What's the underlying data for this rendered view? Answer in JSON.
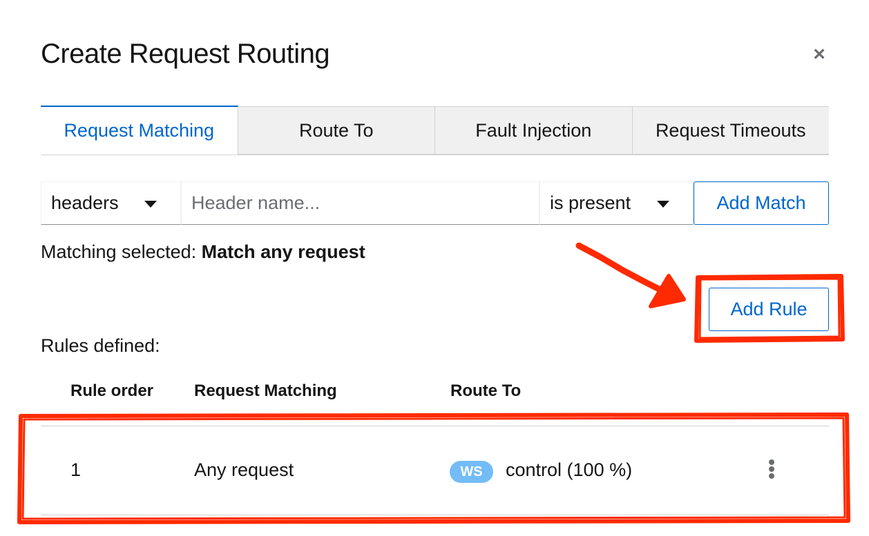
{
  "modal": {
    "title": "Create Request Routing",
    "close_glyph": "×"
  },
  "tabs": [
    {
      "label": "Request Matching",
      "active": true
    },
    {
      "label": "Route To",
      "active": false
    },
    {
      "label": "Fault Injection",
      "active": false
    },
    {
      "label": "Request Timeouts",
      "active": false
    }
  ],
  "match_form": {
    "kind_select": "headers",
    "header_placeholder": "Header name...",
    "operator_select": "is present",
    "add_match_label": "Add Match"
  },
  "matching_selected": {
    "prefix": "Matching selected: ",
    "value": "Match any request"
  },
  "add_rule_label": "Add Rule",
  "rules_defined_label": "Rules defined:",
  "rules_table": {
    "headers": [
      "Rule order",
      "Request Matching",
      "Route To"
    ],
    "rows": [
      {
        "order": "1",
        "matching": "Any request",
        "route_badge": "WS",
        "route_to": "control (100 %)"
      }
    ]
  },
  "colors": {
    "primary": "#0066cc",
    "badge": "#73bcf7",
    "annotation": "#ff2a00"
  },
  "icons": [
    "close-icon",
    "caret-down-icon",
    "kebab-icon"
  ]
}
